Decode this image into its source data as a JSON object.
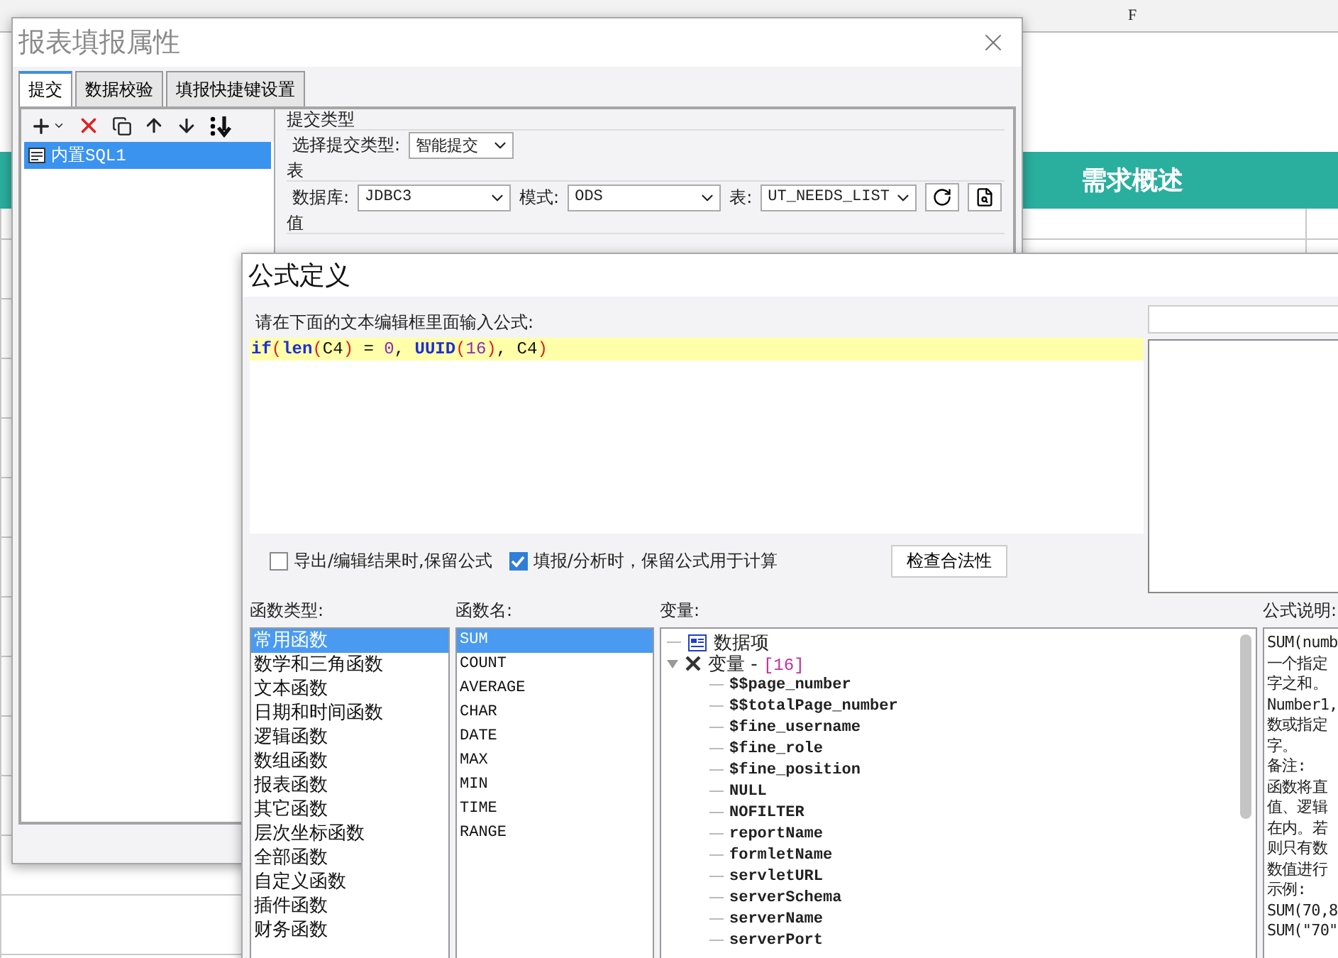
{
  "spreadsheet": {
    "column_header": "F",
    "banner": "需求概述"
  },
  "report_dialog": {
    "title": "报表填报属性",
    "tabs": [
      {
        "label": "提交",
        "selected": true
      },
      {
        "label": "数据校验",
        "selected": false
      },
      {
        "label": "填报快捷键设置",
        "selected": false
      }
    ],
    "submissions": [
      {
        "label": "内置SQL1",
        "selected": true
      }
    ],
    "submit_type": {
      "section": "提交类型",
      "label": "选择提交类型:",
      "value": "智能提交"
    },
    "table_section": {
      "title": "表",
      "database_label": "数据库:",
      "database": "JDBC3",
      "schema_label": "模式:",
      "schema": "ODS",
      "table_label": "表:",
      "table": "UT_NEEDS_LIST"
    },
    "value_section": "值"
  },
  "formula_dialog": {
    "title": "公式定义",
    "prompt": "请在下面的文本编辑框里面输入公式:",
    "formula": [
      {
        "text": "if",
        "kind": "function"
      },
      {
        "text": "(",
        "kind": "paren"
      },
      {
        "text": "len",
        "kind": "function"
      },
      {
        "text": "(",
        "kind": "paren"
      },
      {
        "text": "C4",
        "kind": "plain"
      },
      {
        "text": ")",
        "kind": "paren"
      },
      {
        "text": " = ",
        "kind": "plain"
      },
      {
        "text": "0",
        "kind": "number"
      },
      {
        "text": ", ",
        "kind": "plain"
      },
      {
        "text": "UUID",
        "kind": "function"
      },
      {
        "text": "(",
        "kind": "paren"
      },
      {
        "text": "16",
        "kind": "number"
      },
      {
        "text": ")",
        "kind": "paren"
      },
      {
        "text": ", C4",
        "kind": "plain"
      },
      {
        "text": ")",
        "kind": "paren"
      }
    ],
    "options": [
      {
        "label": "导出/编辑结果时,保留公式",
        "checked": false
      },
      {
        "label": "填报/分析时，保留公式用于计算",
        "checked": true
      }
    ],
    "check_button": "检查合法性",
    "function_types": {
      "label": "函数类型:",
      "items": [
        {
          "label": "常用函数",
          "selected": true
        },
        {
          "label": "数学和三角函数",
          "selected": false
        },
        {
          "label": "文本函数",
          "selected": false
        },
        {
          "label": "日期和时间函数",
          "selected": false
        },
        {
          "label": "逻辑函数",
          "selected": false
        },
        {
          "label": "数组函数",
          "selected": false
        },
        {
          "label": "报表函数",
          "selected": false
        },
        {
          "label": "其它函数",
          "selected": false
        },
        {
          "label": "层次坐标函数",
          "selected": false
        },
        {
          "label": "全部函数",
          "selected": false
        },
        {
          "label": "自定义函数",
          "selected": false
        },
        {
          "label": "插件函数",
          "selected": false
        },
        {
          "label": "财务函数",
          "selected": false
        }
      ]
    },
    "function_names": {
      "label": "函数名:",
      "items": [
        {
          "label": "SUM",
          "selected": true
        },
        {
          "label": "COUNT",
          "selected": false
        },
        {
          "label": "AVERAGE",
          "selected": false
        },
        {
          "label": "CHAR",
          "selected": false
        },
        {
          "label": "DATE",
          "selected": false
        },
        {
          "label": "MAX",
          "selected": false
        },
        {
          "label": "MIN",
          "selected": false
        },
        {
          "label": "TIME",
          "selected": false
        },
        {
          "label": "RANGE",
          "selected": false
        }
      ]
    },
    "variables": {
      "label": "变量:",
      "items": [
        {
          "label": "数据项",
          "kind": "data"
        },
        {
          "label": "变量 - ",
          "count": "[16]",
          "kind": "group",
          "expanded": true,
          "children": [
            {
              "label": "$$page_number"
            },
            {
              "label": "$$totalPage_number"
            },
            {
              "label": "$fine_username"
            },
            {
              "label": "$fine_role"
            },
            {
              "label": "$fine_position"
            },
            {
              "label": "NULL"
            },
            {
              "label": "NOFILTER"
            },
            {
              "label": "reportName"
            },
            {
              "label": "formletName"
            },
            {
              "label": "servletURL"
            },
            {
              "label": "serverSchema"
            },
            {
              "label": "serverName"
            },
            {
              "label": "serverPort"
            }
          ]
        }
      ]
    },
    "description": {
      "label": "公式说明:",
      "lines": [
        "SUM(numb",
        "一个指定",
        "字之和。",
        "Number1,",
        "数或指定",
        "字。",
        "备注:",
        "函数将直",
        "值、逻辑",
        "在内。若",
        "则只有数",
        "数值进行",
        "示例:",
        "SUM(70,8",
        "SUM(\"70\""
      ]
    }
  }
}
